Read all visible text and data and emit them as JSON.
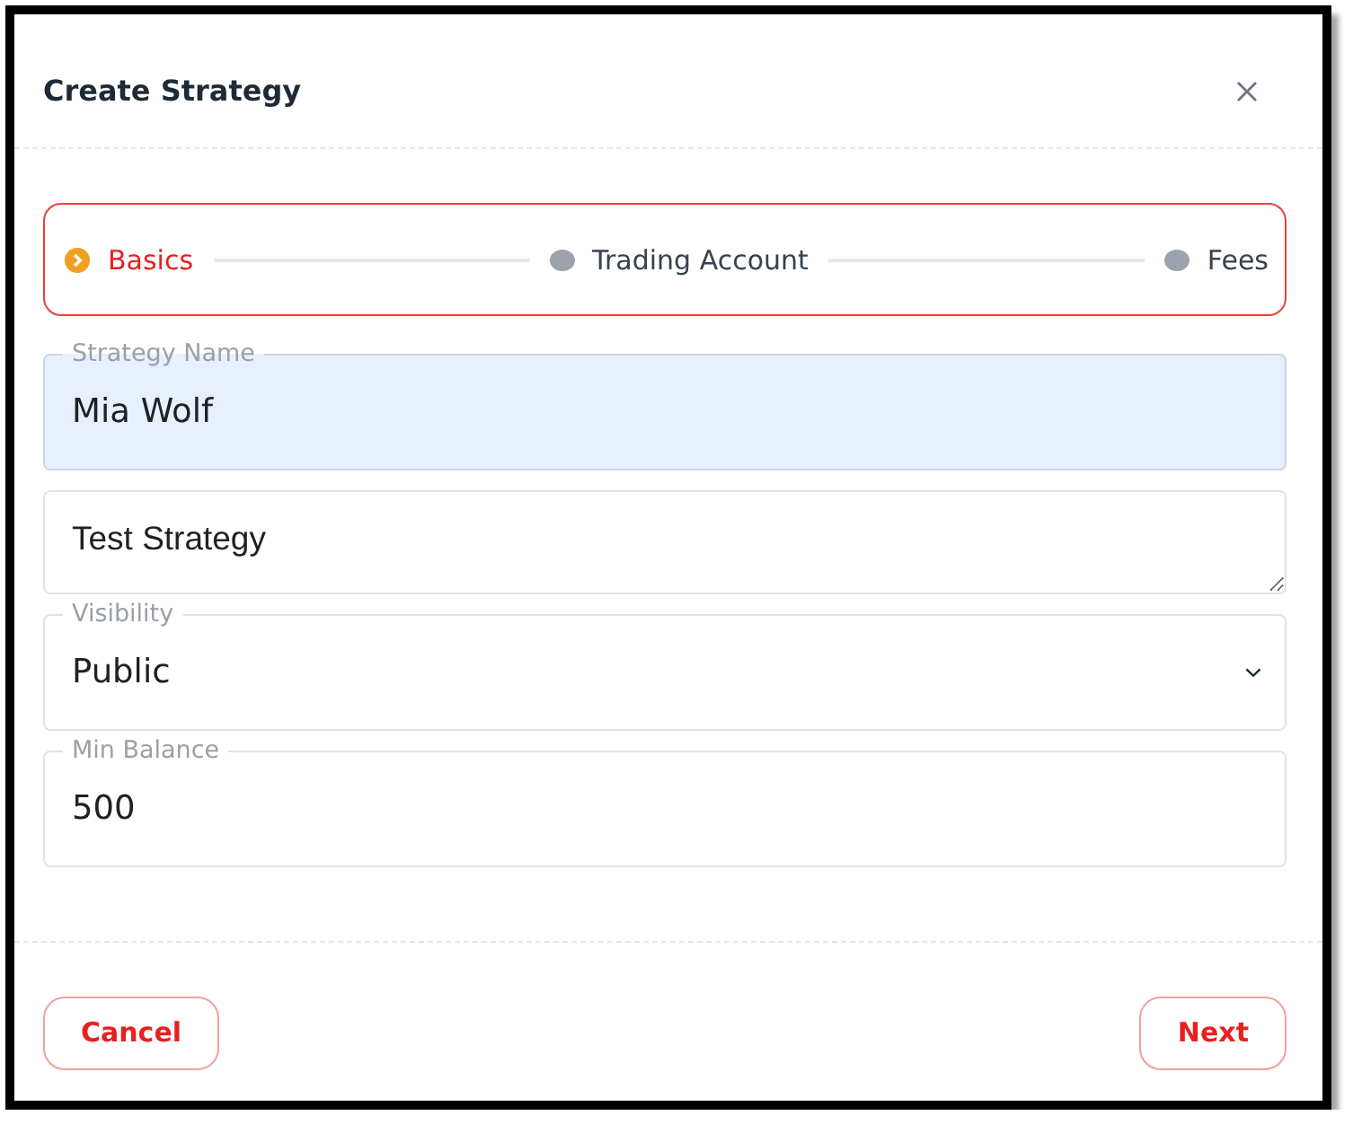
{
  "dialog": {
    "title": "Create Strategy"
  },
  "stepper": {
    "steps": [
      {
        "label": "Basics",
        "selected": true
      },
      {
        "label": "Trading Account",
        "selected": false
      },
      {
        "label": "Fees",
        "selected": false
      }
    ]
  },
  "fields": [
    {
      "kind": "input",
      "label": "Strategy Name",
      "value": "Mia Wolf",
      "autofilled": true
    },
    {
      "kind": "textarea",
      "value": "Test Strategy",
      "autofilled": false
    },
    {
      "kind": "select",
      "label": "Visibility",
      "value": "Public",
      "autofilled": false
    },
    {
      "kind": "input",
      "label": "Min Balance",
      "value": "500",
      "autofilled": false
    }
  ],
  "buttons": [
    {
      "label": "Cancel"
    },
    {
      "label": "Next"
    }
  ]
}
